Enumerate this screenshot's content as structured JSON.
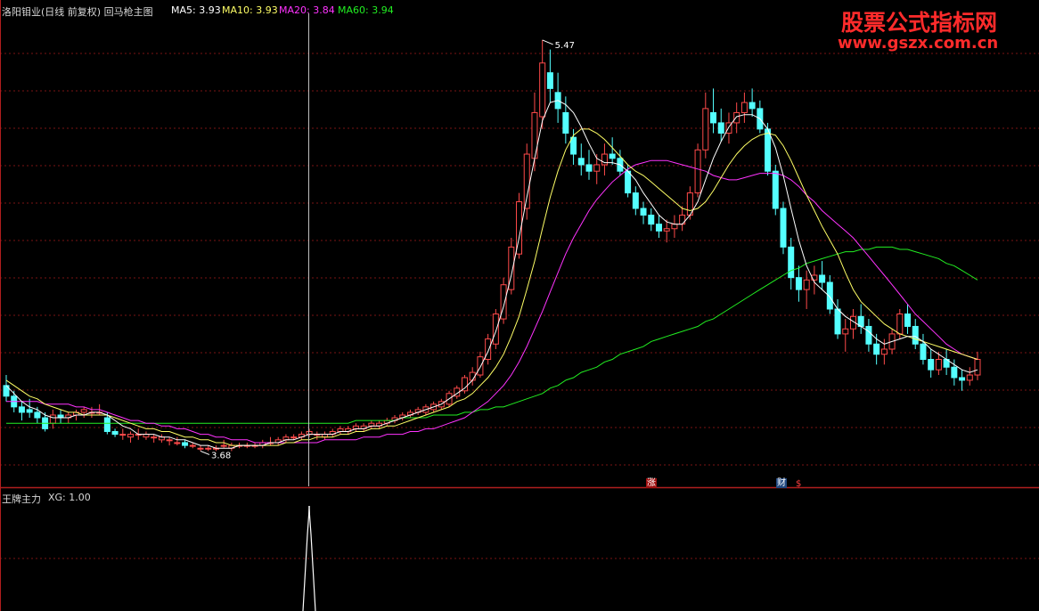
{
  "header": {
    "stock_label": "洛阳钼业(日线 前复权) 回马枪主图",
    "ma5_label": "MA5: 3.93",
    "ma10_label": "MA10: 3.93",
    "ma20_label": "MA20: 3.84",
    "ma60_label": "MA60: 3.94"
  },
  "subpanel": {
    "label": "王牌主力",
    "xg_label": "XG: 1.00"
  },
  "watermark": {
    "title": "股票公式指标网",
    "url": "www.gszx.com.cn"
  },
  "badges": {
    "zhang": "涨",
    "cai": "财",
    "dollar": "$"
  },
  "colors": {
    "up": "#ff4a4a",
    "down": "#54ffff",
    "ma5": "#ffffff",
    "ma10": "#ffff66",
    "ma20": "#ff33ff",
    "ma60": "#22ee22",
    "grid": "#7a1414",
    "frame": "#b01e1e",
    "cursor": "#c0c0c0"
  },
  "chart_data": {
    "type": "candlestick",
    "ylim": [
      3.6,
      5.55
    ],
    "y_mode": "log",
    "high_annotation": "5.47",
    "low_annotation": "3.68",
    "cursor_index": 57,
    "xg_index": 57,
    "candles": [
      [
        3.92,
        3.96,
        3.86,
        3.88
      ],
      [
        3.88,
        3.9,
        3.82,
        3.84
      ],
      [
        3.84,
        3.86,
        3.79,
        3.82
      ],
      [
        3.83,
        3.87,
        3.8,
        3.82
      ],
      [
        3.82,
        3.84,
        3.78,
        3.8
      ],
      [
        3.8,
        3.82,
        3.75,
        3.76
      ],
      [
        3.78,
        3.83,
        3.76,
        3.81
      ],
      [
        3.81,
        3.83,
        3.78,
        3.8
      ],
      [
        3.8,
        3.82,
        3.78,
        3.81
      ],
      [
        3.81,
        3.83,
        3.79,
        3.82
      ],
      [
        3.82,
        3.84,
        3.8,
        3.83
      ],
      [
        3.82,
        3.84,
        3.8,
        3.82
      ],
      [
        3.82,
        3.85,
        3.81,
        3.82
      ],
      [
        3.8,
        3.82,
        3.74,
        3.75
      ],
      [
        3.75,
        3.76,
        3.73,
        3.74
      ],
      [
        3.74,
        3.76,
        3.72,
        3.74
      ],
      [
        3.73,
        3.75,
        3.71,
        3.74
      ],
      [
        3.74,
        3.76,
        3.72,
        3.74
      ],
      [
        3.73,
        3.75,
        3.72,
        3.74
      ],
      [
        3.73,
        3.74,
        3.71,
        3.73
      ],
      [
        3.72,
        3.74,
        3.71,
        3.73
      ],
      [
        3.72,
        3.73,
        3.7,
        3.72
      ],
      [
        3.71,
        3.73,
        3.7,
        3.71
      ],
      [
        3.71,
        3.72,
        3.69,
        3.7
      ],
      [
        3.7,
        3.71,
        3.69,
        3.7
      ],
      [
        3.69,
        3.7,
        3.68,
        3.69
      ],
      [
        3.69,
        3.7,
        3.68,
        3.69
      ],
      [
        3.69,
        3.7,
        3.68,
        3.69
      ],
      [
        3.7,
        3.72,
        3.69,
        3.7
      ],
      [
        3.69,
        3.71,
        3.68,
        3.7
      ],
      [
        3.7,
        3.71,
        3.69,
        3.7
      ],
      [
        3.7,
        3.71,
        3.69,
        3.7
      ],
      [
        3.7,
        3.71,
        3.69,
        3.7
      ],
      [
        3.7,
        3.72,
        3.69,
        3.71
      ],
      [
        3.71,
        3.73,
        3.7,
        3.71
      ],
      [
        3.71,
        3.73,
        3.7,
        3.72
      ],
      [
        3.72,
        3.74,
        3.71,
        3.73
      ],
      [
        3.73,
        3.74,
        3.72,
        3.73
      ],
      [
        3.73,
        3.75,
        3.72,
        3.74
      ],
      [
        3.74,
        3.76,
        3.73,
        3.75
      ],
      [
        3.74,
        3.75,
        3.72,
        3.74
      ],
      [
        3.73,
        3.75,
        3.72,
        3.74
      ],
      [
        3.74,
        3.76,
        3.73,
        3.75
      ],
      [
        3.75,
        3.77,
        3.74,
        3.76
      ],
      [
        3.75,
        3.77,
        3.74,
        3.76
      ],
      [
        3.76,
        3.78,
        3.75,
        3.77
      ],
      [
        3.76,
        3.78,
        3.75,
        3.77
      ],
      [
        3.77,
        3.79,
        3.76,
        3.78
      ],
      [
        3.77,
        3.79,
        3.76,
        3.78
      ],
      [
        3.78,
        3.8,
        3.77,
        3.79
      ],
      [
        3.79,
        3.81,
        3.78,
        3.8
      ],
      [
        3.8,
        3.82,
        3.79,
        3.81
      ],
      [
        3.81,
        3.83,
        3.8,
        3.82
      ],
      [
        3.82,
        3.84,
        3.81,
        3.83
      ],
      [
        3.82,
        3.85,
        3.81,
        3.84
      ],
      [
        3.83,
        3.86,
        3.82,
        3.85
      ],
      [
        3.84,
        3.87,
        3.83,
        3.86
      ],
      [
        3.85,
        3.9,
        3.84,
        3.89
      ],
      [
        3.88,
        3.92,
        3.87,
        3.91
      ],
      [
        3.9,
        3.96,
        3.89,
        3.95
      ],
      [
        3.94,
        3.99,
        3.92,
        3.97
      ],
      [
        3.96,
        4.05,
        3.95,
        4.03
      ],
      [
        4.02,
        4.12,
        4.0,
        4.1
      ],
      [
        4.08,
        4.22,
        4.06,
        4.2
      ],
      [
        4.18,
        4.35,
        4.16,
        4.32
      ],
      [
        4.3,
        4.52,
        4.28,
        4.48
      ],
      [
        4.45,
        4.72,
        4.43,
        4.68
      ],
      [
        4.65,
        4.95,
        4.6,
        4.9
      ],
      [
        4.88,
        5.2,
        4.82,
        5.1
      ],
      [
        5.08,
        5.47,
        5.02,
        5.35
      ],
      [
        5.3,
        5.42,
        5.15,
        5.22
      ],
      [
        5.2,
        5.3,
        5.05,
        5.12
      ],
      [
        5.1,
        5.18,
        4.95,
        5.0
      ],
      [
        4.98,
        5.02,
        4.85,
        4.9
      ],
      [
        4.88,
        4.95,
        4.8,
        4.85
      ],
      [
        4.85,
        4.92,
        4.78,
        4.82
      ],
      [
        4.82,
        4.9,
        4.76,
        4.85
      ],
      [
        4.85,
        4.95,
        4.8,
        4.9
      ],
      [
        4.9,
        4.98,
        4.85,
        4.88
      ],
      [
        4.88,
        4.92,
        4.8,
        4.82
      ],
      [
        4.82,
        4.85,
        4.7,
        4.72
      ],
      [
        4.72,
        4.75,
        4.62,
        4.65
      ],
      [
        4.65,
        4.68,
        4.58,
        4.62
      ],
      [
        4.62,
        4.65,
        4.55,
        4.58
      ],
      [
        4.58,
        4.62,
        4.52,
        4.55
      ],
      [
        4.55,
        4.6,
        4.5,
        4.56
      ],
      [
        4.56,
        4.62,
        4.52,
        4.58
      ],
      [
        4.58,
        4.66,
        4.55,
        4.62
      ],
      [
        4.62,
        4.75,
        4.6,
        4.72
      ],
      [
        4.72,
        4.95,
        4.7,
        4.92
      ],
      [
        4.92,
        5.2,
        4.88,
        5.12
      ],
      [
        5.1,
        5.22,
        5.0,
        5.05
      ],
      [
        5.05,
        5.12,
        4.96,
        5.0
      ],
      [
        5.0,
        5.1,
        4.95,
        5.05
      ],
      [
        5.05,
        5.15,
        5.0,
        5.1
      ],
      [
        5.1,
        5.2,
        5.05,
        5.15
      ],
      [
        5.15,
        5.22,
        5.08,
        5.12
      ],
      [
        5.12,
        5.16,
        5.0,
        5.02
      ],
      [
        5.02,
        5.05,
        4.8,
        4.82
      ],
      [
        4.82,
        4.85,
        4.62,
        4.65
      ],
      [
        4.65,
        4.68,
        4.45,
        4.48
      ],
      [
        4.48,
        4.52,
        4.3,
        4.35
      ],
      [
        4.35,
        4.4,
        4.25,
        4.3
      ],
      [
        4.3,
        4.38,
        4.22,
        4.34
      ],
      [
        4.34,
        4.4,
        4.28,
        4.36
      ],
      [
        4.36,
        4.42,
        4.3,
        4.33
      ],
      [
        4.33,
        4.36,
        4.2,
        4.22
      ],
      [
        4.22,
        4.26,
        4.1,
        4.12
      ],
      [
        4.12,
        4.18,
        4.05,
        4.14
      ],
      [
        4.14,
        4.22,
        4.1,
        4.19
      ],
      [
        4.19,
        4.24,
        4.12,
        4.15
      ],
      [
        4.15,
        4.18,
        4.05,
        4.08
      ],
      [
        4.08,
        4.12,
        4.0,
        4.04
      ],
      [
        4.04,
        4.1,
        4.0,
        4.06
      ],
      [
        4.06,
        4.14,
        4.04,
        4.12
      ],
      [
        4.12,
        4.22,
        4.1,
        4.2
      ],
      [
        4.2,
        4.24,
        4.12,
        4.15
      ],
      [
        4.15,
        4.18,
        4.06,
        4.08
      ],
      [
        4.08,
        4.12,
        4.0,
        4.02
      ],
      [
        4.02,
        4.06,
        3.95,
        3.98
      ],
      [
        3.98,
        4.05,
        3.96,
        4.02
      ],
      [
        4.02,
        4.06,
        3.96,
        3.99
      ],
      [
        3.99,
        4.02,
        3.92,
        3.95
      ],
      [
        3.95,
        3.98,
        3.9,
        3.94
      ],
      [
        3.94,
        3.99,
        3.92,
        3.96
      ],
      [
        3.96,
        4.05,
        3.94,
        4.02
      ]
    ],
    "ma5": [
      3.92,
      3.89,
      3.86,
      3.84,
      3.83,
      3.81,
      3.8,
      3.8,
      3.8,
      3.81,
      3.81,
      3.82,
      3.82,
      3.81,
      3.79,
      3.77,
      3.76,
      3.74,
      3.74,
      3.74,
      3.73,
      3.73,
      3.72,
      3.72,
      3.71,
      3.7,
      3.7,
      3.69,
      3.69,
      3.69,
      3.7,
      3.7,
      3.7,
      3.7,
      3.71,
      3.71,
      3.72,
      3.72,
      3.73,
      3.74,
      3.74,
      3.74,
      3.74,
      3.75,
      3.75,
      3.76,
      3.76,
      3.77,
      3.77,
      3.78,
      3.79,
      3.8,
      3.81,
      3.82,
      3.83,
      3.84,
      3.85,
      3.87,
      3.89,
      3.91,
      3.94,
      3.99,
      4.05,
      4.13,
      4.23,
      4.36,
      4.52,
      4.7,
      4.88,
      5.06,
      5.15,
      5.16,
      5.14,
      5.1,
      5.03,
      4.95,
      4.88,
      4.86,
      4.86,
      4.85,
      4.82,
      4.78,
      4.72,
      4.67,
      4.62,
      4.59,
      4.58,
      4.58,
      4.62,
      4.68,
      4.78,
      4.88,
      4.96,
      5.03,
      5.08,
      5.09,
      5.09,
      5.07,
      5.02,
      4.93,
      4.8,
      4.65,
      4.51,
      4.4,
      4.33,
      4.3,
      4.27,
      4.22,
      4.19,
      4.17,
      4.15,
      4.13,
      4.1,
      4.08,
      4.09,
      4.1,
      4.11,
      4.11,
      4.09,
      4.06,
      4.04,
      4.02,
      4.0,
      3.98,
      3.97,
      3.98
    ],
    "ma10": [
      3.94,
      3.92,
      3.9,
      3.88,
      3.87,
      3.85,
      3.84,
      3.83,
      3.82,
      3.82,
      3.81,
      3.81,
      3.81,
      3.81,
      3.8,
      3.79,
      3.78,
      3.77,
      3.76,
      3.76,
      3.75,
      3.75,
      3.74,
      3.73,
      3.73,
      3.72,
      3.72,
      3.71,
      3.71,
      3.7,
      3.7,
      3.7,
      3.7,
      3.7,
      3.7,
      3.7,
      3.71,
      3.71,
      3.72,
      3.72,
      3.73,
      3.73,
      3.73,
      3.74,
      3.74,
      3.75,
      3.75,
      3.76,
      3.76,
      3.77,
      3.77,
      3.78,
      3.79,
      3.8,
      3.81,
      3.82,
      3.83,
      3.84,
      3.86,
      3.87,
      3.89,
      3.92,
      3.95,
      3.99,
      4.04,
      4.11,
      4.19,
      4.3,
      4.42,
      4.56,
      4.7,
      4.82,
      4.92,
      4.99,
      5.02,
      5.02,
      5.0,
      4.97,
      4.93,
      4.89,
      4.85,
      4.82,
      4.8,
      4.77,
      4.74,
      4.71,
      4.68,
      4.65,
      4.64,
      4.65,
      4.68,
      4.73,
      4.79,
      4.85,
      4.9,
      4.94,
      4.97,
      4.99,
      5.0,
      4.99,
      4.94,
      4.87,
      4.79,
      4.71,
      4.64,
      4.57,
      4.51,
      4.45,
      4.37,
      4.3,
      4.25,
      4.22,
      4.19,
      4.16,
      4.14,
      4.12,
      4.11,
      4.1,
      4.09,
      4.08,
      4.07,
      4.06,
      4.05,
      4.04,
      4.03,
      4.02
    ],
    "ma20": [
      3.86,
      3.86,
      3.86,
      3.86,
      3.86,
      3.85,
      3.85,
      3.85,
      3.85,
      3.84,
      3.84,
      3.83,
      3.83,
      3.82,
      3.81,
      3.8,
      3.79,
      3.79,
      3.78,
      3.78,
      3.77,
      3.77,
      3.76,
      3.76,
      3.75,
      3.74,
      3.74,
      3.73,
      3.73,
      3.72,
      3.72,
      3.72,
      3.71,
      3.71,
      3.71,
      3.71,
      3.71,
      3.71,
      3.71,
      3.71,
      3.71,
      3.72,
      3.72,
      3.72,
      3.72,
      3.72,
      3.73,
      3.73,
      3.73,
      3.74,
      3.74,
      3.74,
      3.75,
      3.75,
      3.76,
      3.76,
      3.77,
      3.78,
      3.79,
      3.8,
      3.82,
      3.84,
      3.86,
      3.89,
      3.92,
      3.96,
      4.01,
      4.07,
      4.14,
      4.21,
      4.29,
      4.37,
      4.45,
      4.52,
      4.58,
      4.64,
      4.69,
      4.73,
      4.77,
      4.8,
      4.83,
      4.85,
      4.86,
      4.87,
      4.87,
      4.87,
      4.86,
      4.85,
      4.84,
      4.83,
      4.82,
      4.8,
      4.79,
      4.78,
      4.78,
      4.79,
      4.8,
      4.81,
      4.81,
      4.81,
      4.8,
      4.78,
      4.75,
      4.71,
      4.68,
      4.64,
      4.61,
      4.58,
      4.55,
      4.52,
      4.48,
      4.44,
      4.4,
      4.36,
      4.32,
      4.28,
      4.24,
      4.2,
      4.17,
      4.14,
      4.11,
      4.08,
      4.06,
      4.04,
      4.03,
      4.02
    ],
    "ma60": [
      3.78,
      3.78,
      3.78,
      3.78,
      3.78,
      3.78,
      3.78,
      3.78,
      3.78,
      3.78,
      3.78,
      3.78,
      3.78,
      3.78,
      3.78,
      3.78,
      3.78,
      3.78,
      3.78,
      3.78,
      3.78,
      3.78,
      3.78,
      3.78,
      3.78,
      3.78,
      3.78,
      3.78,
      3.78,
      3.78,
      3.78,
      3.78,
      3.78,
      3.78,
      3.78,
      3.78,
      3.78,
      3.78,
      3.78,
      3.78,
      3.78,
      3.78,
      3.78,
      3.78,
      3.78,
      3.79,
      3.79,
      3.79,
      3.79,
      3.79,
      3.79,
      3.8,
      3.8,
      3.8,
      3.8,
      3.81,
      3.81,
      3.81,
      3.81,
      3.82,
      3.82,
      3.83,
      3.83,
      3.84,
      3.84,
      3.85,
      3.86,
      3.87,
      3.88,
      3.89,
      3.91,
      3.92,
      3.94,
      3.95,
      3.97,
      3.98,
      3.99,
      4.01,
      4.02,
      4.04,
      4.05,
      4.06,
      4.07,
      4.09,
      4.1,
      4.11,
      4.12,
      4.13,
      4.14,
      4.15,
      4.17,
      4.18,
      4.2,
      4.22,
      4.24,
      4.26,
      4.28,
      4.3,
      4.32,
      4.34,
      4.36,
      4.38,
      4.39,
      4.41,
      4.42,
      4.43,
      4.44,
      4.45,
      4.46,
      4.46,
      4.47,
      4.47,
      4.48,
      4.48,
      4.48,
      4.47,
      4.47,
      4.46,
      4.45,
      4.44,
      4.43,
      4.41,
      4.4,
      4.38,
      4.36,
      4.34
    ]
  }
}
